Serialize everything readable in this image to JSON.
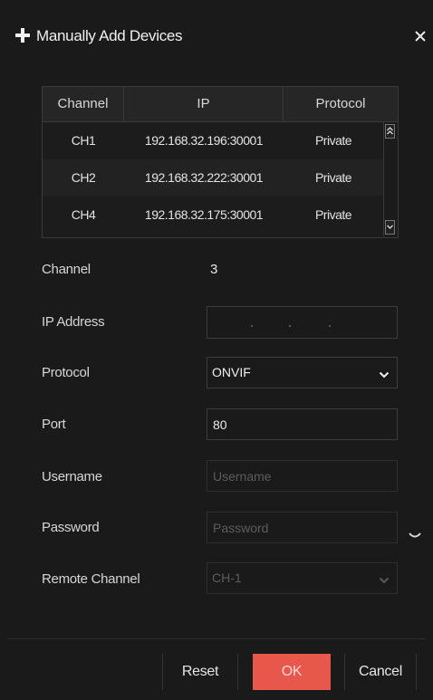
{
  "dialog": {
    "title": "Manually Add Devices"
  },
  "table": {
    "headers": [
      "Channel",
      "IP",
      "Protocol"
    ],
    "rows": [
      {
        "channel": "CH1",
        "ip": "192.168.32.196:30001",
        "protocol": "Private"
      },
      {
        "channel": "CH2",
        "ip": "192.168.32.222:30001",
        "protocol": "Private"
      },
      {
        "channel": "CH4",
        "ip": "192.168.32.175:30001",
        "protocol": "Private"
      }
    ]
  },
  "form": {
    "channel_label": "Channel",
    "channel_value": "3",
    "ip_label": "IP Address",
    "protocol_label": "Protocol",
    "protocol_value": "ONVIF",
    "port_label": "Port",
    "port_value": "80",
    "username_label": "Username",
    "username_placeholder": "Username",
    "password_label": "Password",
    "password_placeholder": "Password",
    "remote_channel_label": "Remote Channel",
    "remote_channel_value": "CH-1"
  },
  "footer": {
    "reset_label": "Reset",
    "ok_label": "OK",
    "cancel_label": "Cancel"
  },
  "colors": {
    "background": "#1a1a1a",
    "accent": "#e8574b",
    "border": "#3a3a3a"
  },
  "icons": {
    "add": "plus-icon",
    "close": "close-icon",
    "dropdown": "chevron-down-icon",
    "scroll_up": "arrow-up-icon",
    "scroll_down": "arrow-down-icon"
  }
}
